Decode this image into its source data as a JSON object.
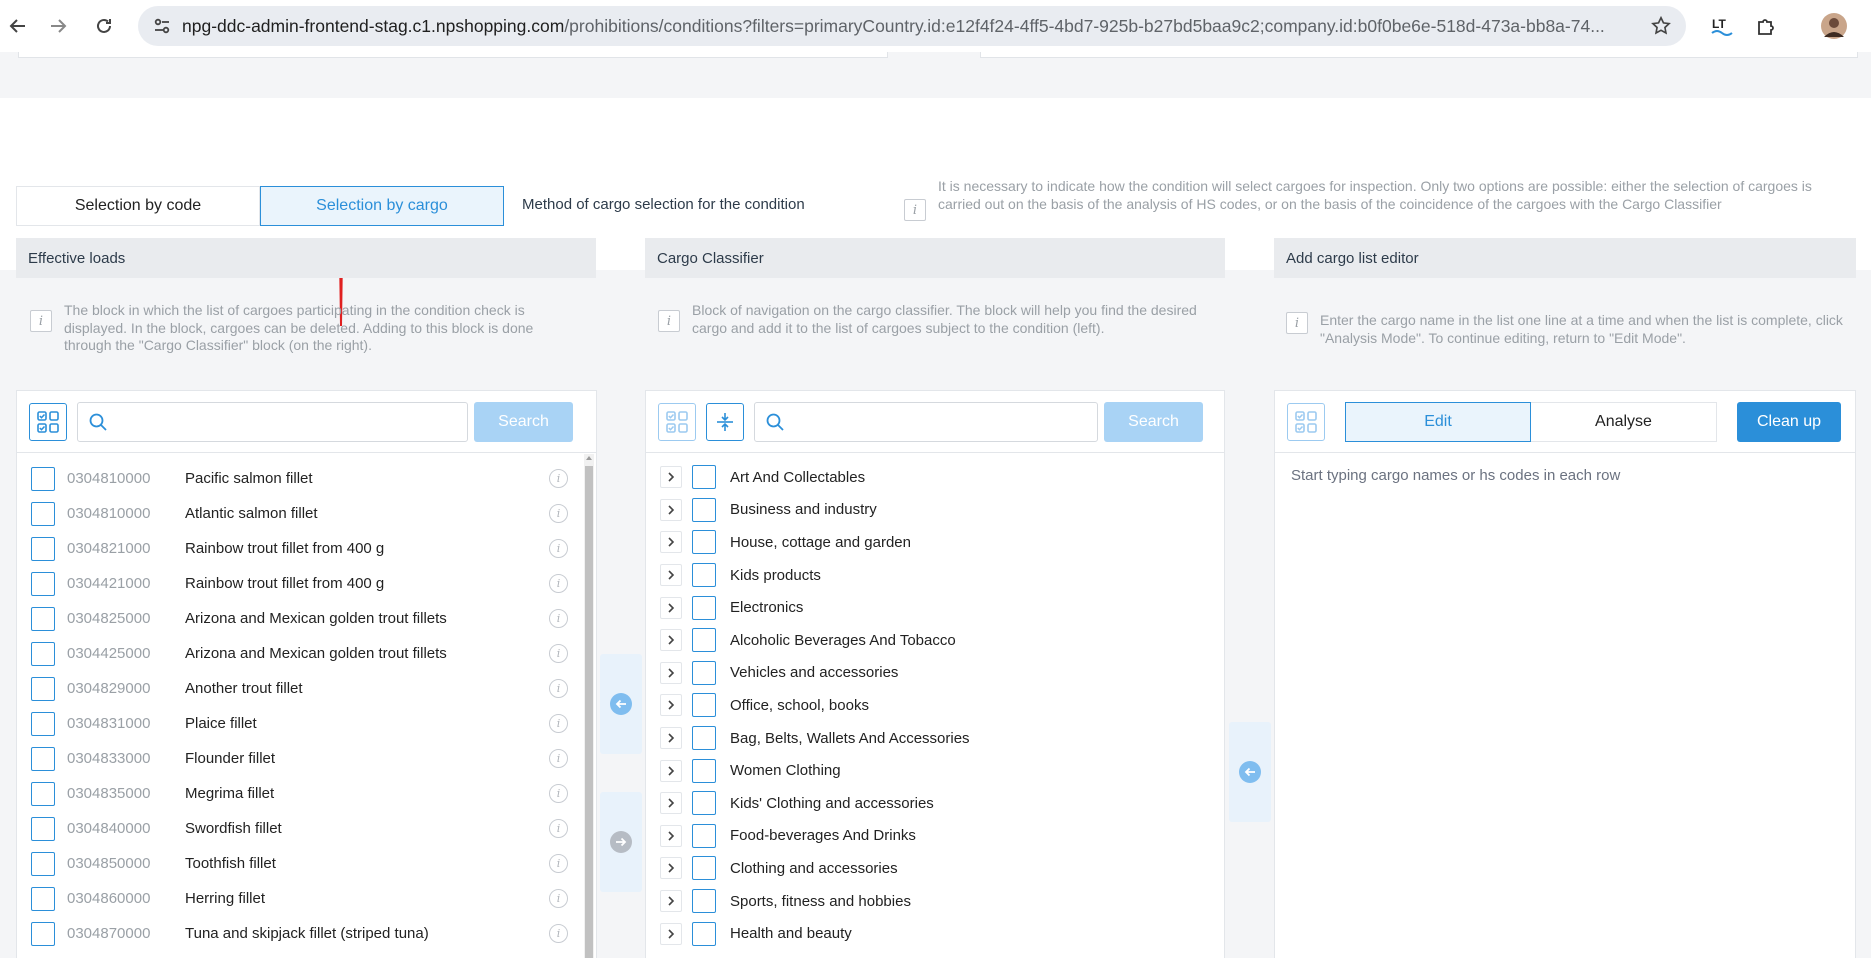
{
  "browser": {
    "url_host": "npg-ddc-admin-frontend-stag.c1.npshopping.com",
    "url_path": "/prohibitions/conditions?filters=primaryCountry.id:e12f4f24-4ff5-4bd7-925b-b27bd5baa9c2;company.id:b0f0be6e-518d-473a-bb8a-74..."
  },
  "method": {
    "options": [
      "Selection by code",
      "Selection by cargo"
    ],
    "active_index": 1,
    "label": "Method of cargo selection for the condition",
    "help": "It is necessary to indicate how the condition will select cargoes for inspection. Only two options are possible: either the selection of cargoes is carried out on the basis of the analysis of HS codes, or on the basis of the coincidence of the cargoes with the Cargo Classifier"
  },
  "effective": {
    "title": "Effective loads",
    "help": "The block in which the list of cargoes participating in the condition check is displayed. In the block, cargoes can be deleted. Adding to this block is done through the \"Cargo Classifier\" block (on the right).",
    "search_placeholder": "",
    "search_label": "Search",
    "items": [
      {
        "code": "0304810000",
        "name": "Pacific salmon fillet"
      },
      {
        "code": "0304810000",
        "name": "Atlantic salmon fillet"
      },
      {
        "code": "0304821000",
        "name": "Rainbow trout fillet from 400 g"
      },
      {
        "code": "0304421000",
        "name": "Rainbow trout fillet from 400 g"
      },
      {
        "code": "0304825000",
        "name": "Arizona and Mexican golden trout fillets"
      },
      {
        "code": "0304425000",
        "name": "Arizona and Mexican golden trout fillets"
      },
      {
        "code": "0304829000",
        "name": "Another trout fillet"
      },
      {
        "code": "0304831000",
        "name": "Plaice fillet"
      },
      {
        "code": "0304833000",
        "name": "Flounder fillet"
      },
      {
        "code": "0304835000",
        "name": "Megrima fillet"
      },
      {
        "code": "0304840000",
        "name": "Swordfish fillet"
      },
      {
        "code": "0304850000",
        "name": "Toothfish fillet"
      },
      {
        "code": "0304860000",
        "name": "Herring fillet"
      },
      {
        "code": "0304870000",
        "name": "Tuna and skipjack fillet (striped tuna)"
      }
    ]
  },
  "classifier": {
    "title": "Cargo Classifier",
    "help": "Block of navigation on the cargo classifier. The block will help you find the desired cargo and add it to the list of cargoes subject to the condition (left).",
    "search_placeholder": "",
    "search_label": "Search",
    "items": [
      "Art And Collectables",
      "Business and industry",
      "House, cottage and garden",
      "Kids products",
      "Electronics",
      "Alcoholic Beverages And Tobacco",
      "Vehicles and accessories",
      "Office, school, books",
      "Bag, Belts, Wallets And Accessories",
      "Women Clothing",
      "Kids' Clothing and accessories",
      "Food-beverages And Drinks",
      "Clothing and accessories",
      "Sports, fitness and hobbies",
      "Health and beauty"
    ]
  },
  "editor": {
    "title": "Add cargo list editor",
    "help": "Enter the cargo name in the list one line at a time and when the list is complete, click \"Analysis Mode\". To continue editing, return to \"Edit Mode\".",
    "tab_edit": "Edit",
    "tab_analyse": "Analyse",
    "clean_up": "Clean up",
    "placeholder": "Start typing cargo names or hs codes in each row"
  },
  "colors": {
    "accent": "#2b8fd9",
    "accent_light": "#a9d3f5",
    "annotation_arrow": "#e02020"
  }
}
